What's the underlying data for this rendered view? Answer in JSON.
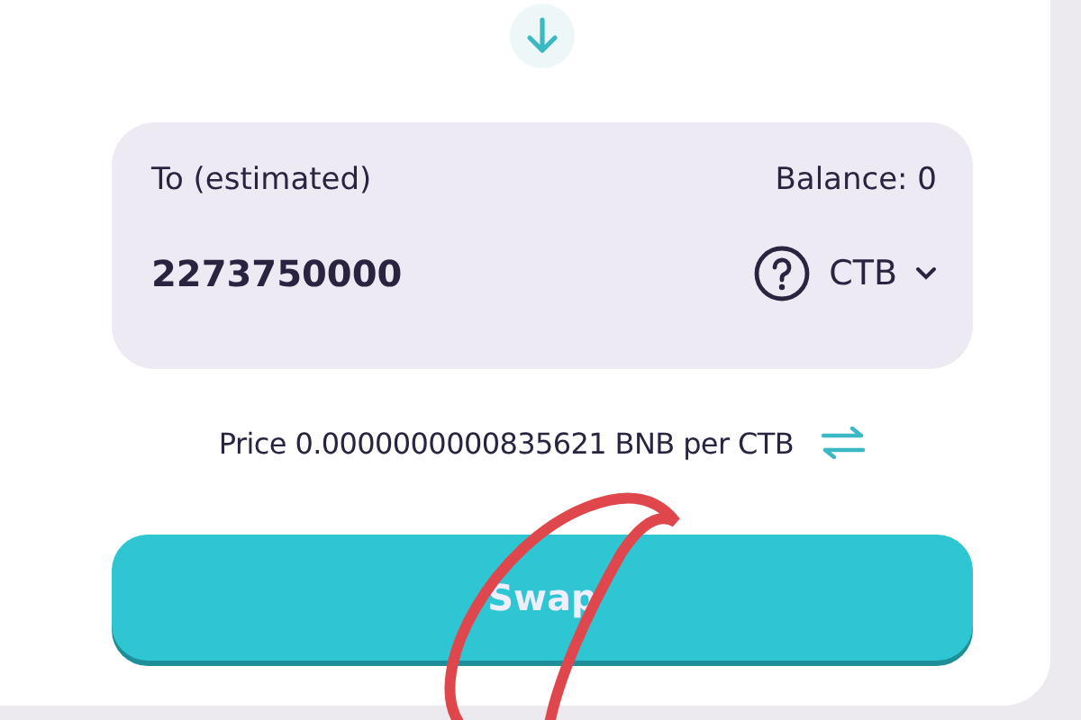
{
  "to_panel": {
    "label": "To (estimated)",
    "balance": "Balance: 0",
    "amount": "2273750000",
    "token": "CTB"
  },
  "price": {
    "label": "Price",
    "value": "0.0000000000835621 BNB per CTB"
  },
  "swap_button": {
    "label": "Swap"
  }
}
